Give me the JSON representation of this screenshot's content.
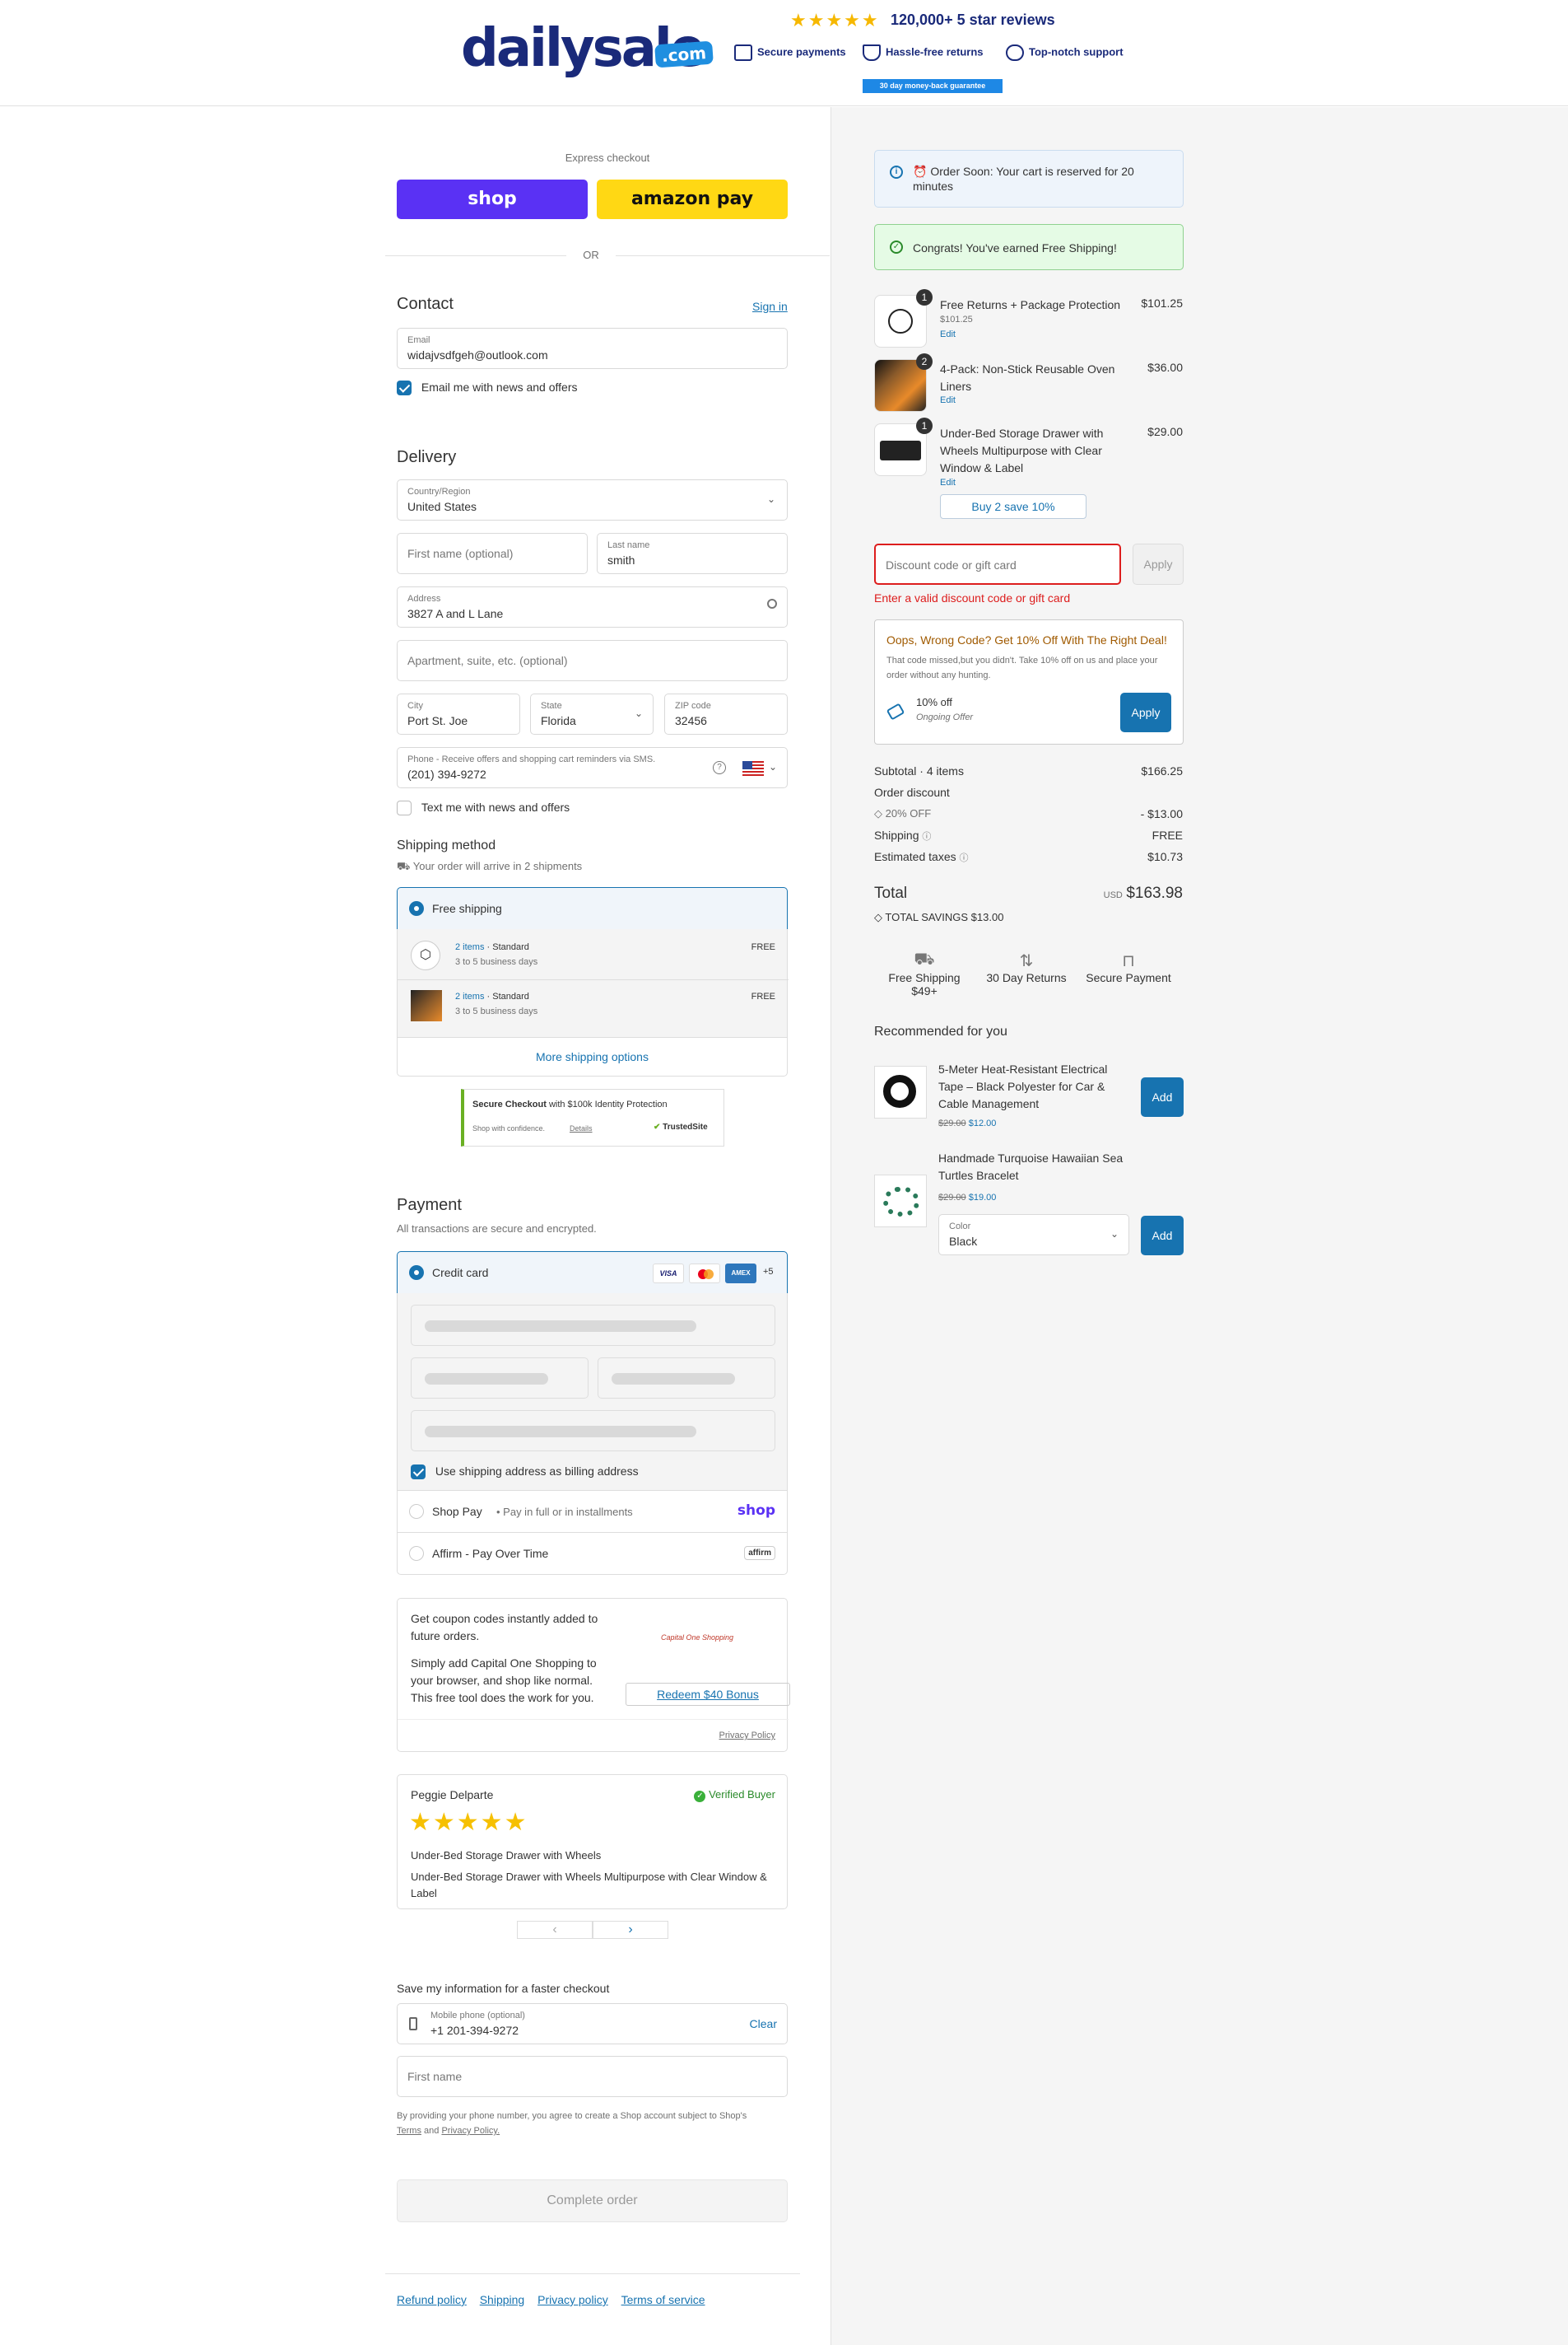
{
  "header": {
    "logo_text": "dailysale",
    "logo_badge": ".com",
    "stars": "★★★★★",
    "reviews_text": "120,000+ 5 star reviews",
    "trust_payments": "Secure payments",
    "trust_returns": "Hassle-free returns",
    "trust_support": "Top-notch support",
    "guarantee": "30 day money-back guarantee"
  },
  "express": {
    "title": "Express checkout",
    "shop_label": "shop",
    "amazon_label": "amazon pay",
    "or": "OR"
  },
  "contact": {
    "title": "Contact",
    "sign_in": "Sign in",
    "email_label": "Email",
    "email_value": "widajvsdfgeh@outlook.com",
    "news_label": "Email me with news and offers"
  },
  "delivery": {
    "title": "Delivery",
    "country_label": "Country/Region",
    "country_value": "United States",
    "first_name_ph": "First name (optional)",
    "last_name_label": "Last name",
    "last_name_value": "smith",
    "address_label": "Address",
    "address_value": "3827 A and L Lane",
    "apt_ph": "Apartment, suite, etc. (optional)",
    "city_label": "City",
    "city_value": "Port St. Joe",
    "state_label": "State",
    "state_value": "Florida",
    "zip_label": "ZIP code",
    "zip_value": "32456",
    "phone_label": "Phone - Receive offers and shopping cart reminders via SMS.",
    "phone_value": "(201) 394-9272",
    "text_label": "Text me with news and offers"
  },
  "shipping": {
    "title": "Shipping method",
    "subtitle": "Your order will arrive in 2 shipments",
    "free_label": "Free shipping",
    "shipments": [
      {
        "items": "2 items",
        "method": "Standard",
        "days": "3 to 5 business days",
        "price": "FREE"
      },
      {
        "items": "2 items",
        "method": "Standard",
        "days": "3 to 5 business days",
        "price": "FREE"
      }
    ],
    "more_options": "More shipping options",
    "secure_checkout": "Secure Checkout",
    "identity": "with $100k Identity Protection",
    "confidence": "Shop with confidence.",
    "details": "Details",
    "trustedsite": "TrustedSite"
  },
  "payment": {
    "title": "Payment",
    "subtitle": "All transactions are secure and encrypted.",
    "credit_card": "Credit card",
    "card_visa": "VISA",
    "card_amex": "AMEX",
    "card_more": "+5",
    "billing_label": "Use shipping address as billing address",
    "shop_pay": "Shop Pay",
    "shop_pay_sub": "Pay in full or in installments",
    "shop_logo": "shop",
    "affirm": "Affirm - Pay Over Time",
    "affirm_logo": "affirm"
  },
  "capital_one": {
    "text1": "Get coupon codes instantly added to future orders.",
    "text2": "Simply add Capital One Shopping to your browser, and shop like normal. This free tool does the work for you.",
    "logo": "Capital One Shopping",
    "redeem": "Redeem $40 Bonus",
    "privacy": "Privacy Policy"
  },
  "review": {
    "name": "Peggie Delparte",
    "verified": "Verified Buyer",
    "stars": "★★★★★",
    "product": "Under-Bed Storage Drawer with Wheels",
    "body": "Under-Bed Storage Drawer with Wheels Multipurpose with Clear Window & Label",
    "prev": "‹",
    "next": "›"
  },
  "save_info": {
    "title": "Save my information for a faster checkout",
    "mobile_label": "Mobile phone (optional)",
    "mobile_value": "+1 201-394-9272",
    "clear": "Clear",
    "first_name_ph": "First name",
    "legal": "By providing your phone number, you agree to create a Shop account subject to Shop's",
    "terms": "Terms",
    "and": "and",
    "privacy": "Privacy Policy."
  },
  "complete_order": "Complete order",
  "footer_links": [
    "Refund policy",
    "Shipping",
    "Privacy policy",
    "Terms of service"
  ],
  "summary": {
    "reserved": "⏰ Order Soon: Your cart is reserved for 20 minutes",
    "free_ship_msg": "Congrats! You've earned Free Shipping!",
    "items": [
      {
        "qty": "1",
        "name": "Free Returns + Package Protection",
        "sub": "$101.25",
        "edit": "Edit",
        "price": "$101.25"
      },
      {
        "qty": "2",
        "name": "4-Pack: Non-Stick Reusable Oven Liners",
        "sub": "",
        "edit": "Edit",
        "price": "$36.00"
      },
      {
        "qty": "1",
        "name": "Under-Bed Storage Drawer with Wheels Multipurpose with Clear Window & Label",
        "sub": "",
        "edit": "Edit",
        "price": "$29.00"
      }
    ],
    "buy2": "Buy 2 save 10%",
    "discount_ph": "Discount code or gift card",
    "apply": "Apply",
    "discount_error": "Enter a valid discount code or gift card",
    "oops_title": "Oops, Wrong Code? Get 10% Off With The Right Deal!",
    "oops_body": "That code missed,but you didn't. Take 10% off on us and place your order without any hunting.",
    "offer_title": "10% off",
    "offer_sub": "Ongoing Offer",
    "offer_apply": "Apply",
    "subtotal_label": "Subtotal · 4 items",
    "subtotal": "$166.25",
    "order_discount": "Order discount",
    "discount_code": "20% OFF",
    "discount_value": "- $13.00",
    "shipping_label": "Shipping",
    "shipping_value": "FREE",
    "taxes_label": "Estimated taxes",
    "taxes_value": "$10.73",
    "total_label": "Total",
    "currency": "USD",
    "total_value": "$163.98",
    "savings_label": "TOTAL SAVINGS",
    "savings_value": "$13.00",
    "badge_shipping": "Free Shipping $49+",
    "badge_returns": "30 Day Returns",
    "badge_secure": "Secure Payment",
    "recommended_title": "Recommended for you",
    "rec": [
      {
        "name": "5-Meter Heat-Resistant Electrical Tape – Black Polyester for Car & Cable Management",
        "old_price": "$29.00",
        "price": "$12.00",
        "add": "Add"
      },
      {
        "name": "Handmade Turquoise Hawaiian Sea Turtles Bracelet",
        "old_price": "$29.00",
        "price": "$19.00",
        "add": "Add",
        "color_label": "Color",
        "color_value": "Black"
      }
    ]
  },
  "colors": {
    "accent": "#1773b0",
    "error": "#dd1d1d",
    "success_bg": "#e5fbe5",
    "shop_purple": "#5a31f4",
    "amazon_yellow": "#ffd814"
  }
}
